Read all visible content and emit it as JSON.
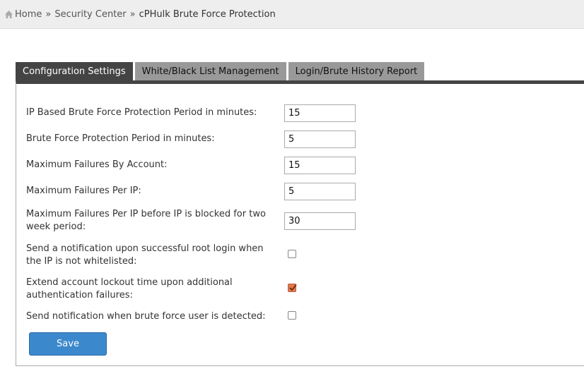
{
  "breadcrumb": {
    "home": "Home",
    "separator": "»",
    "section": "Security Center",
    "current": "cPHulk Brute Force Protection"
  },
  "tabs": [
    {
      "label": "Configuration Settings",
      "active": true
    },
    {
      "label": "White/Black List Management",
      "active": false
    },
    {
      "label": "Login/Brute History Report",
      "active": false
    }
  ],
  "settings": {
    "ip_period": {
      "label": "IP Based Brute Force Protection Period in minutes:",
      "value": "15"
    },
    "bf_period": {
      "label": "Brute Force Protection Period in minutes:",
      "value": "5"
    },
    "max_fail_account": {
      "label": "Maximum Failures By Account:",
      "value": "15"
    },
    "max_fail_ip": {
      "label": "Maximum Failures Per IP:",
      "value": "5"
    },
    "max_fail_ip_twoweek": {
      "label": "Maximum Failures Per IP before IP is blocked for two week period:",
      "value": "30"
    },
    "notify_root_login": {
      "label": "Send a notification upon successful root login when the IP is not whitelisted:",
      "checked": false
    },
    "extend_lockout": {
      "label": "Extend account lockout time upon additional authentication failures:",
      "checked": true
    },
    "notify_brute_user": {
      "label": "Send notification when brute force user is detected:",
      "checked": false
    }
  },
  "save_label": "Save",
  "colors": {
    "tab_active": "#444444",
    "tab_inactive": "#999999",
    "save_button": "#3c88cc",
    "checkbox_checked": "#e07a50"
  }
}
